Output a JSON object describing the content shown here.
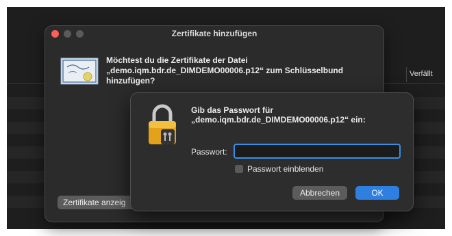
{
  "background_app": {
    "column_header": "Verfällt"
  },
  "sheet": {
    "title": "Zertifikate hinzufügen",
    "message_lines": [
      "Möchtest du die Zertifikate der Datei",
      "„demo.iqm.bdr.de_DIMDEMO00006.p12“ zum Schlüsselbund",
      "hinzufügen?"
    ],
    "show_certs_button": "Zertifikate anzeig",
    "icon": "certificate-icon"
  },
  "password_dialog": {
    "heading_lines": [
      "Gib das Passwort für",
      "„demo.iqm.bdr.de_DIMDEMO00006.p12“ ein:"
    ],
    "password_label": "Passwort:",
    "password_value": "",
    "show_password_label": "Passwort einblenden",
    "show_password_checked": false,
    "cancel_label": "Abbrechen",
    "ok_label": "OK",
    "icon": "keychain-lock-icon"
  },
  "colors": {
    "accent": "#2f7fe0",
    "close_button": "#fe5f57",
    "dialog_background": "#2d2d2d"
  }
}
